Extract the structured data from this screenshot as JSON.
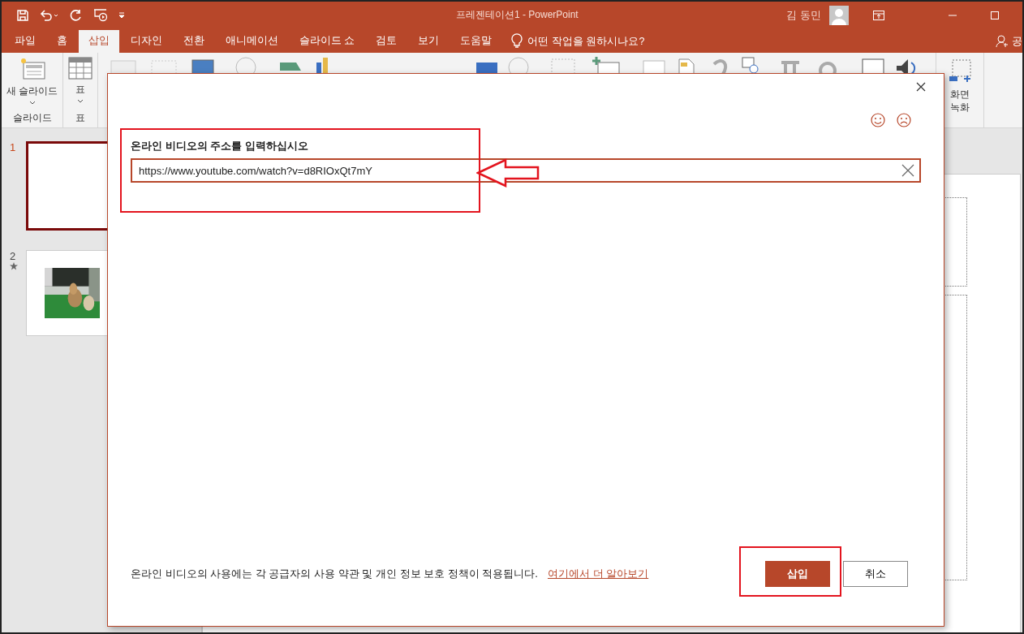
{
  "window": {
    "title": "프레젠테이션1  -  PowerPoint",
    "user": "김 동민"
  },
  "tabs": [
    {
      "label": "파일",
      "selected": false
    },
    {
      "label": "홈",
      "selected": false
    },
    {
      "label": "삽입",
      "selected": true
    },
    {
      "label": "디자인",
      "selected": false
    },
    {
      "label": "전환",
      "selected": false
    },
    {
      "label": "애니메이션",
      "selected": false
    },
    {
      "label": "슬라이드 쇼",
      "selected": false
    },
    {
      "label": "검토",
      "selected": false
    },
    {
      "label": "보기",
      "selected": false
    },
    {
      "label": "도움말",
      "selected": false
    }
  ],
  "tell_me": "어떤 작업을 원하시나요?",
  "share": "공",
  "ribbon": {
    "new_slide": "새 슬라이드",
    "slides_group": "슬라이드",
    "table": "표",
    "table_group": "표",
    "screen_recording": "화면 녹화"
  },
  "slides": [
    {
      "number": "1",
      "selected": true,
      "kind": "blank",
      "animated": false
    },
    {
      "number": "2",
      "selected": false,
      "kind": "picture",
      "animated": true
    }
  ],
  "dialog": {
    "label": "온라인 비디오의 주소를 입력하십시오",
    "url": "https://www.youtube.com/watch?v=d8RIOxQt7mY",
    "note": "온라인 비디오의 사용에는 각 공급자의 사용 약관 및 개인 정보 보호 정책이 적용됩니다.",
    "link": "여기에서 더 알아보기",
    "buttons": [
      {
        "label": "삽입",
        "primary": true
      },
      {
        "label": "취소",
        "primary": false
      }
    ]
  }
}
